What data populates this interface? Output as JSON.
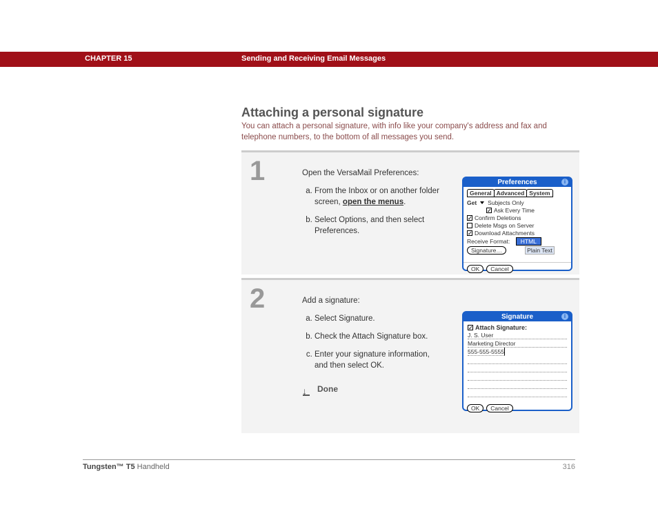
{
  "header": {
    "chapter": "CHAPTER 15",
    "title": "Sending and Receiving Email Messages"
  },
  "section": {
    "title": "Attaching a personal signature",
    "intro": "You can attach a personal signature, with info like your company's address and fax and telephone numbers, to the bottom of all messages you send."
  },
  "step1": {
    "num": "1",
    "lead": "Open the VersaMail Preferences:",
    "a_pre": "From the Inbox or on another folder screen, ",
    "a_link": "open the menus",
    "a_post": ".",
    "b": "Select Options, and then select Preferences."
  },
  "prefs": {
    "title": "Preferences",
    "tabs": {
      "general": "General",
      "advanced": "Advanced",
      "system": "System"
    },
    "get": "Get",
    "subjects": "Subjects Only",
    "ask": "Ask Every Time",
    "confirm": "Confirm Deletions",
    "delete": "Delete Msgs on Server",
    "download": "Download Attachments",
    "recvfmt": "Receive Format:",
    "html": "HTML",
    "plain": "Plain Text",
    "sigbtn": "Signature…",
    "ok": "OK",
    "cancel": "Cancel"
  },
  "step2": {
    "num": "2",
    "lead": "Add a signature:",
    "a": "Select Signature.",
    "b": "Check the Attach Signature box.",
    "c": "Enter your signature information, and then select OK.",
    "done": "Done"
  },
  "sig": {
    "title": "Signature",
    "attach": "Attach Signature:",
    "line1": "J. S. User",
    "line2": "Marketing Director",
    "line3": "555-555-5555",
    "ok": "OK",
    "cancel": "Cancel"
  },
  "footer": {
    "product_bold": "Tungsten™ T5",
    "product_rest": " Handheld",
    "page": "316"
  }
}
